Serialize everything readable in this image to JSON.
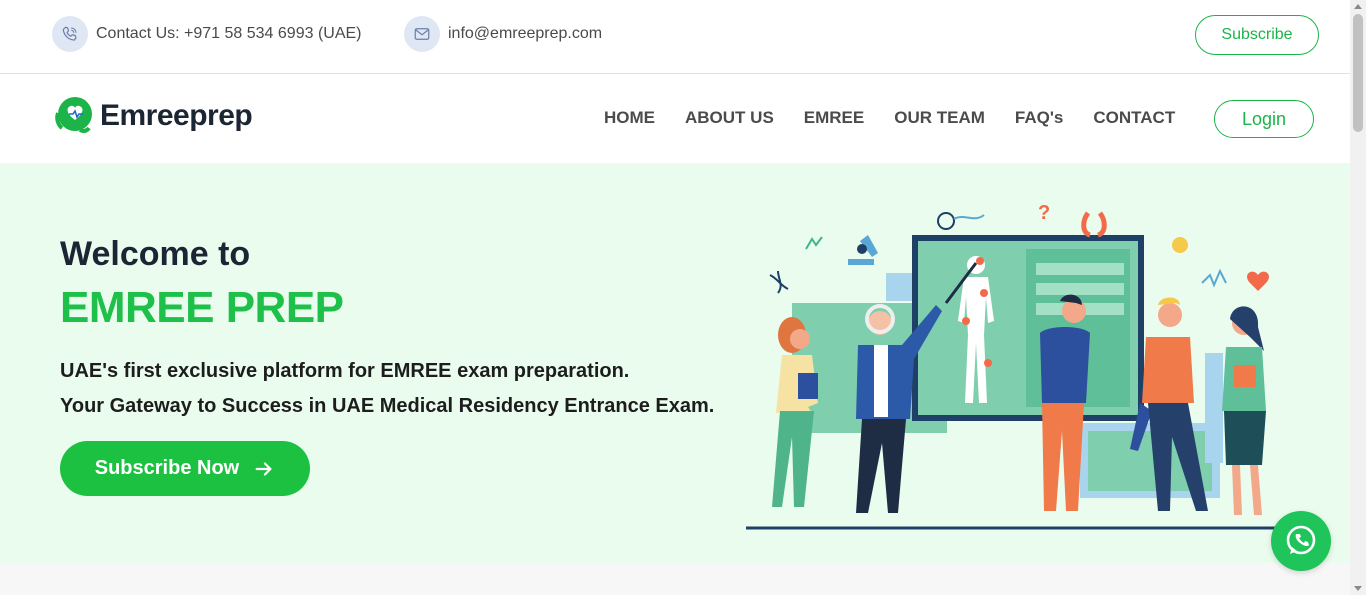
{
  "topbar": {
    "phone": {
      "icon": "phone-icon",
      "text": "Contact Us: +971 58 534 6993 (UAE)"
    },
    "email": {
      "icon": "mail-icon",
      "text": "info@emreeprep.com"
    },
    "subscribe_label": "Subscribe"
  },
  "navbar": {
    "logo_text": "Emreeprep",
    "links": [
      "HOME",
      "ABOUT US",
      "EMREE",
      "OUR TEAM",
      "FAQ's",
      "CONTACT"
    ],
    "login_label": "Login"
  },
  "hero": {
    "welcome": "Welcome to",
    "brand": "EMREE PREP",
    "line1": "UAE's first exclusive platform for EMREE exam preparation.",
    "line2": "Your Gateway to Success in UAE Medical Residency Entrance Exam.",
    "cta_label": "Subscribe Now"
  },
  "floating": {
    "whatsapp_icon": "whatsapp-icon"
  },
  "colors": {
    "accent": "#1cc142",
    "hero_bg": "#e9fcee",
    "text_dark": "#1c2533"
  }
}
